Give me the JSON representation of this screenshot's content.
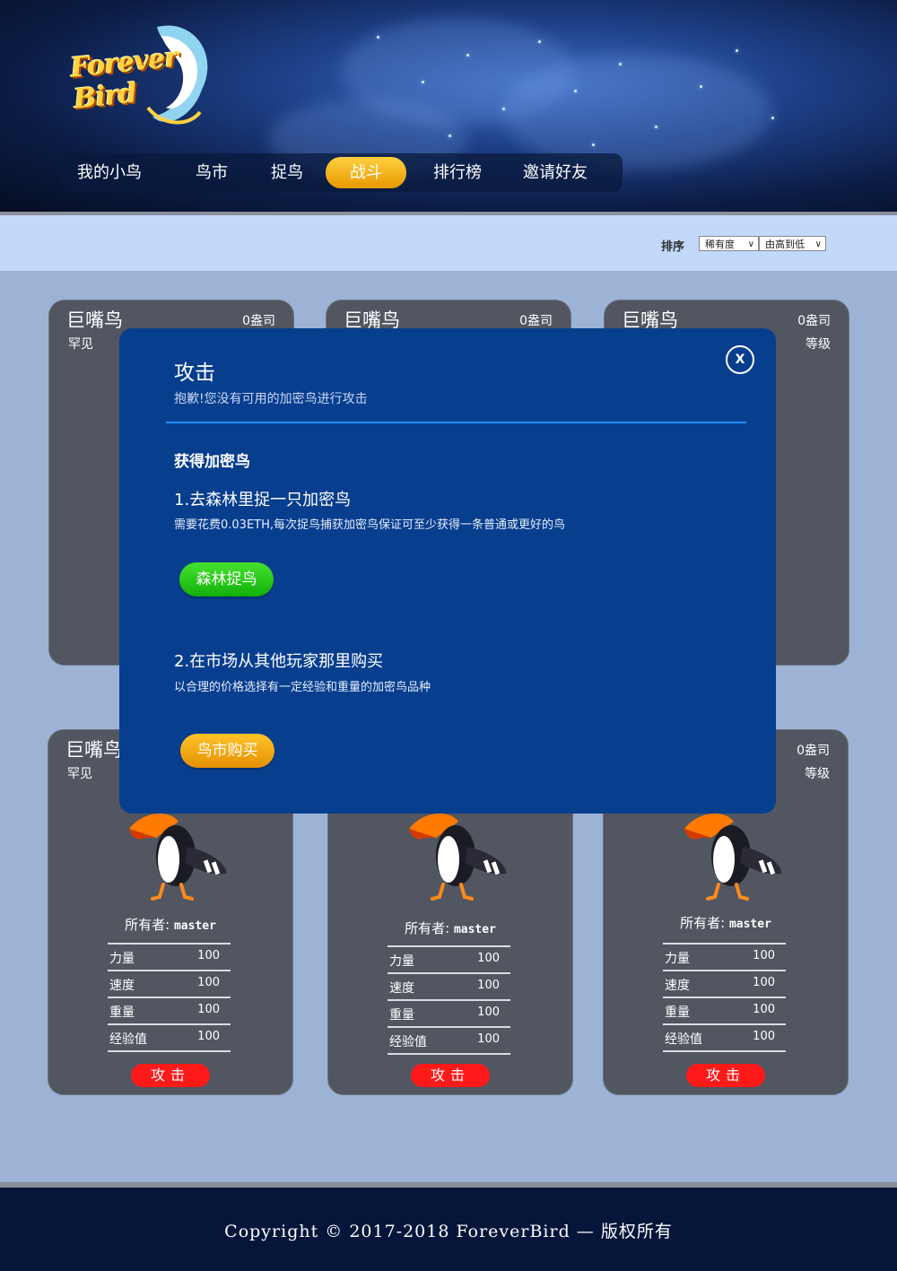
{
  "logo": {
    "text": "Forever Bird"
  },
  "nav": {
    "items": [
      {
        "label": "我的小鸟",
        "active": false
      },
      {
        "label": "鸟市",
        "active": false
      },
      {
        "label": "捉鸟",
        "active": false
      },
      {
        "label": "战斗",
        "active": true
      },
      {
        "label": "排行榜",
        "active": false
      },
      {
        "label": "邀请好友",
        "active": false
      }
    ]
  },
  "sort": {
    "label": "排序",
    "field_value": "稀有度",
    "order_value": "由高到低"
  },
  "cards": [
    {
      "name": "巨嘴鸟",
      "price": "0盎司",
      "rarity": "罕见",
      "level": ""
    },
    {
      "name": "巨嘴鸟",
      "price": "0盎司",
      "rarity": "",
      "level": ""
    },
    {
      "name": "巨嘴鸟",
      "price": "0盎司",
      "rarity": "",
      "level": "等级"
    },
    {
      "name": "巨嘴鸟",
      "price": "",
      "rarity": "罕见",
      "level": "",
      "owner_label": "所有者:",
      "owner": "master",
      "stats": [
        {
          "k": "力量",
          "v": "100"
        },
        {
          "k": "速度",
          "v": "100"
        },
        {
          "k": "重量",
          "v": "100"
        },
        {
          "k": "经验值",
          "v": "100"
        }
      ],
      "attack_label": "攻击"
    },
    {
      "name": "",
      "price": "",
      "rarity": "",
      "level": "",
      "owner_label": "所有者:",
      "owner": "master",
      "stats": [
        {
          "k": "力量",
          "v": "100"
        },
        {
          "k": "速度",
          "v": "100"
        },
        {
          "k": "重量",
          "v": "100"
        },
        {
          "k": "经验值",
          "v": "100"
        }
      ],
      "attack_label": "攻击"
    },
    {
      "name": "",
      "price": "0盎司",
      "rarity": "",
      "level": "等级",
      "owner_label": "所有者:",
      "owner": "master",
      "stats": [
        {
          "k": "力量",
          "v": "100"
        },
        {
          "k": "速度",
          "v": "100"
        },
        {
          "k": "重量",
          "v": "100"
        },
        {
          "k": "经验值",
          "v": "100"
        }
      ],
      "attack_label": "攻击"
    }
  ],
  "modal": {
    "title": "攻击",
    "subtitle": "抱歉!您没有可用的加密鸟进行攻击",
    "close_label": "X",
    "section_title": "获得加密鸟",
    "option1_title": "1.去森林里捉一只加密鸟",
    "option1_desc": "需要花费0.03ETH,每次捉鸟捕获加密鸟保证可至少获得一条普通或更好的鸟",
    "option1_button": "森林捉鸟",
    "option2_title": "2.在市场从其他玩家那里购买",
    "option2_desc": "以合理的价格选择有一定经验和重量的加密鸟品种",
    "option2_button": "鸟市购买"
  },
  "footer": {
    "copyright": "Copyright © 2017-2018 ForeverBird — 版权所有"
  }
}
